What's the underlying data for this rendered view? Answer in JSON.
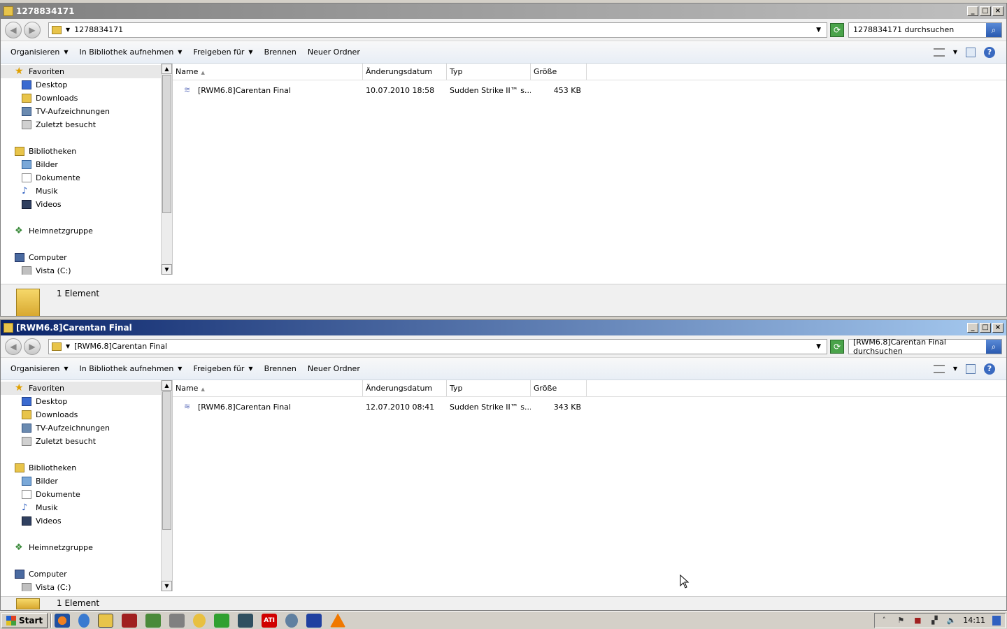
{
  "windows": [
    {
      "title": "1278834171",
      "address": "1278834171",
      "search_placeholder": "1278834171 durchsuchen",
      "toolbar": {
        "organize": "Organisieren",
        "library": "In Bibliothek aufnehmen",
        "share": "Freigeben für",
        "burn": "Brennen",
        "new_folder": "Neuer Ordner"
      },
      "nav": {
        "favorites": "Favoriten",
        "desktop": "Desktop",
        "downloads": "Downloads",
        "tv": "TV-Aufzeichnungen",
        "recent": "Zuletzt besucht",
        "libraries": "Bibliotheken",
        "pictures": "Bilder",
        "documents": "Dokumente",
        "music": "Musik",
        "videos": "Videos",
        "homegroup": "Heimnetzgruppe",
        "computer": "Computer",
        "drive": "Vista (C:)"
      },
      "columns": {
        "name": "Name",
        "date": "Änderungsdatum",
        "type": "Typ",
        "size": "Größe"
      },
      "files": [
        {
          "name": "[RWM6.8]Carentan Final",
          "date": "10.07.2010 18:58",
          "type": "Sudden Strike II™ s...",
          "size": "453 KB"
        }
      ],
      "status": "1 Element"
    },
    {
      "title": "[RWM6.8]Carentan Final",
      "address": "[RWM6.8]Carentan Final",
      "search_placeholder": "[RWM6.8]Carentan Final durchsuchen",
      "toolbar": {
        "organize": "Organisieren",
        "library": "In Bibliothek aufnehmen",
        "share": "Freigeben für",
        "burn": "Brennen",
        "new_folder": "Neuer Ordner"
      },
      "nav": {
        "favorites": "Favoriten",
        "desktop": "Desktop",
        "downloads": "Downloads",
        "tv": "TV-Aufzeichnungen",
        "recent": "Zuletzt besucht",
        "libraries": "Bibliotheken",
        "pictures": "Bilder",
        "documents": "Dokumente",
        "music": "Musik",
        "videos": "Videos",
        "homegroup": "Heimnetzgruppe",
        "computer": "Computer",
        "drive": "Vista (C:)"
      },
      "columns": {
        "name": "Name",
        "date": "Änderungsdatum",
        "type": "Typ",
        "size": "Größe"
      },
      "files": [
        {
          "name": "[RWM6.8]Carentan Final",
          "date": "12.07.2010 08:41",
          "type": "Sudden Strike II™ s...",
          "size": "343 KB"
        }
      ],
      "status": "1 Element"
    }
  ],
  "taskbar": {
    "start": "Start",
    "clock": "14:11",
    "apps": [
      "firefox-icon",
      "ie-icon",
      "explorer-icon",
      "app-red-icon",
      "app-map-icon",
      "app-gear-icon",
      "app-face-icon",
      "app-clover-icon",
      "app-monitor-icon",
      "ati-icon",
      "app-wave-icon",
      "app-blue-icon",
      "vlc-icon"
    ],
    "ati_label": "ATI"
  }
}
